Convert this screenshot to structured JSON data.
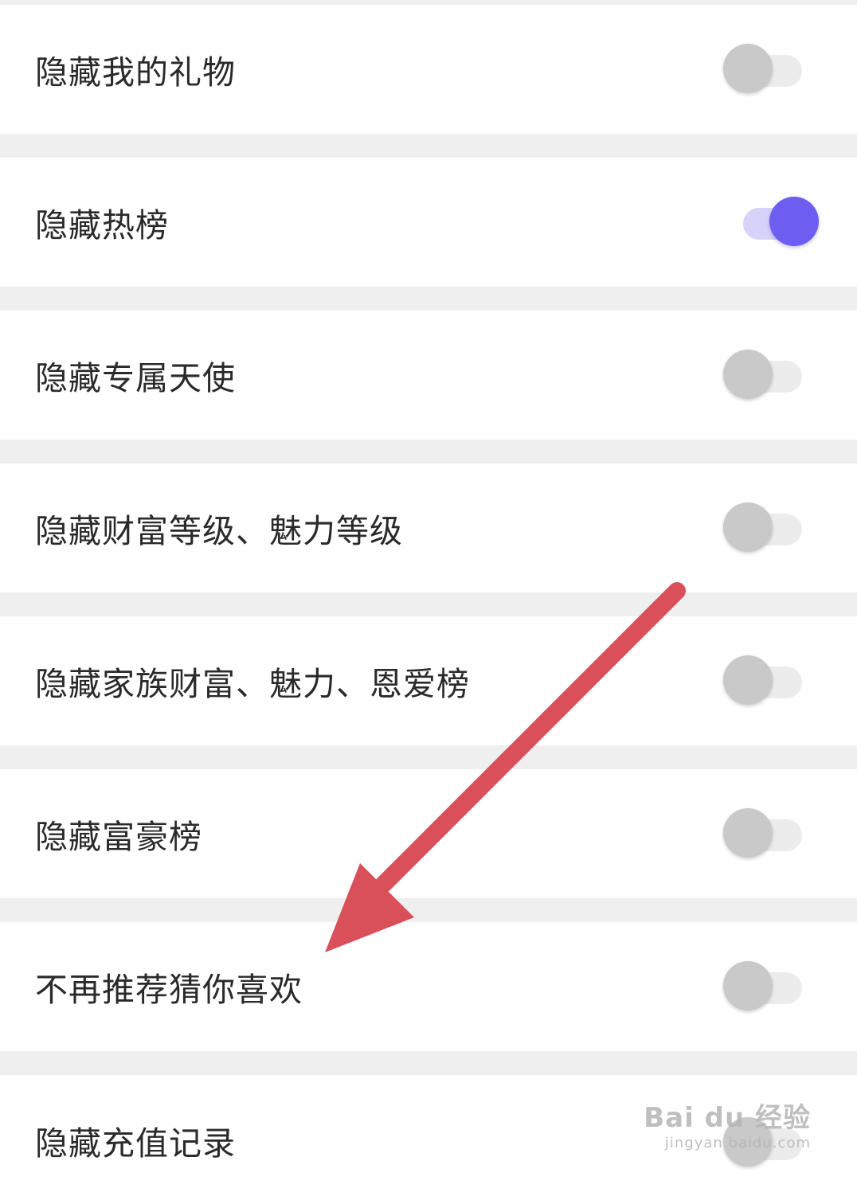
{
  "settings": [
    {
      "label": "隐藏我的礼物",
      "enabled": false
    },
    {
      "label": "隐藏热榜",
      "enabled": true
    },
    {
      "label": "隐藏专属天使",
      "enabled": false
    },
    {
      "label": "隐藏财富等级、魅力等级",
      "enabled": false
    },
    {
      "label": "隐藏家族财富、魅力、恩爱榜",
      "enabled": false
    },
    {
      "label": "隐藏富豪榜",
      "enabled": false
    },
    {
      "label": "不再推荐猜你喜欢",
      "enabled": false
    },
    {
      "label": "隐藏充值记录",
      "enabled": false
    }
  ],
  "colors": {
    "toggle_on": "#6b5ef0",
    "toggle_on_track": "#d7d2fa",
    "toggle_off": "#c9c9c9",
    "arrow": "#d9505a"
  },
  "annotation": {
    "arrow_icon": "red-arrow-icon"
  },
  "watermark": {
    "logo": "Bai du 经验",
    "url": "jingyan.baidu.com"
  }
}
